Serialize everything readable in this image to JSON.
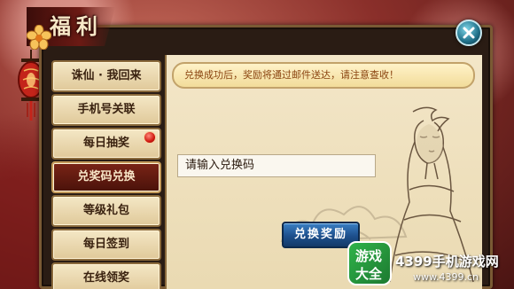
{
  "window": {
    "title": "福利"
  },
  "sidebar": {
    "items": [
      {
        "label": "诛仙 · 我回来",
        "active": false,
        "badge": false
      },
      {
        "label": "手机号关联",
        "active": false,
        "badge": false
      },
      {
        "label": "每日抽奖",
        "active": false,
        "badge": true
      },
      {
        "label": "兑奖码兑换",
        "active": true,
        "badge": false
      },
      {
        "label": "等级礼包",
        "active": false,
        "badge": false
      },
      {
        "label": "每日签到",
        "active": false,
        "badge": false
      },
      {
        "label": "在线领奖",
        "active": false,
        "badge": false
      }
    ]
  },
  "main": {
    "notice": "兑换成功后，奖励将通过邮件送达，请注意查收！",
    "code_input": {
      "value": "请输入兑换码"
    },
    "redeem_button_label": "兑换奖励"
  },
  "watermark": {
    "badge_top": "游戏",
    "badge_bottom": "大全",
    "brand": "4399手机游戏网",
    "url": "www.4399.cn"
  },
  "colors": {
    "accent_red": "#7a2416",
    "parchment": "#f3e6c8",
    "button_blue": "#1d4f8c",
    "notice_text": "#8a4410"
  },
  "icons": [
    "flower-icon",
    "lantern-icon",
    "close-icon",
    "red-dot-icon"
  ]
}
